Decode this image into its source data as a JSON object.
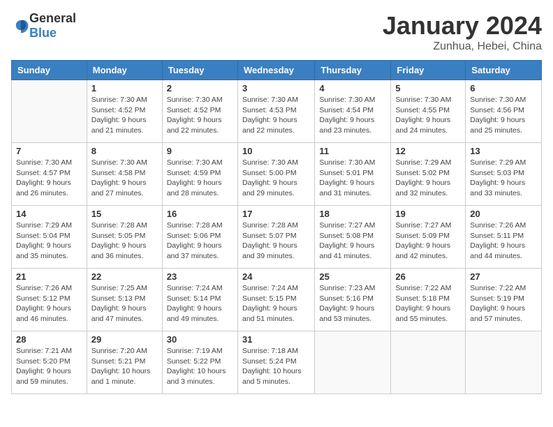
{
  "header": {
    "logo_general": "General",
    "logo_blue": "Blue",
    "month": "January 2024",
    "location": "Zunhua, Hebei, China"
  },
  "columns": [
    "Sunday",
    "Monday",
    "Tuesday",
    "Wednesday",
    "Thursday",
    "Friday",
    "Saturday"
  ],
  "weeks": [
    [
      {
        "day": "",
        "info": ""
      },
      {
        "day": "1",
        "info": "Sunrise: 7:30 AM\nSunset: 4:52 PM\nDaylight: 9 hours\nand 21 minutes."
      },
      {
        "day": "2",
        "info": "Sunrise: 7:30 AM\nSunset: 4:52 PM\nDaylight: 9 hours\nand 22 minutes."
      },
      {
        "day": "3",
        "info": "Sunrise: 7:30 AM\nSunset: 4:53 PM\nDaylight: 9 hours\nand 22 minutes."
      },
      {
        "day": "4",
        "info": "Sunrise: 7:30 AM\nSunset: 4:54 PM\nDaylight: 9 hours\nand 23 minutes."
      },
      {
        "day": "5",
        "info": "Sunrise: 7:30 AM\nSunset: 4:55 PM\nDaylight: 9 hours\nand 24 minutes."
      },
      {
        "day": "6",
        "info": "Sunrise: 7:30 AM\nSunset: 4:56 PM\nDaylight: 9 hours\nand 25 minutes."
      }
    ],
    [
      {
        "day": "7",
        "info": "Sunrise: 7:30 AM\nSunset: 4:57 PM\nDaylight: 9 hours\nand 26 minutes."
      },
      {
        "day": "8",
        "info": "Sunrise: 7:30 AM\nSunset: 4:58 PM\nDaylight: 9 hours\nand 27 minutes."
      },
      {
        "day": "9",
        "info": "Sunrise: 7:30 AM\nSunset: 4:59 PM\nDaylight: 9 hours\nand 28 minutes."
      },
      {
        "day": "10",
        "info": "Sunrise: 7:30 AM\nSunset: 5:00 PM\nDaylight: 9 hours\nand 29 minutes."
      },
      {
        "day": "11",
        "info": "Sunrise: 7:30 AM\nSunset: 5:01 PM\nDaylight: 9 hours\nand 31 minutes."
      },
      {
        "day": "12",
        "info": "Sunrise: 7:29 AM\nSunset: 5:02 PM\nDaylight: 9 hours\nand 32 minutes."
      },
      {
        "day": "13",
        "info": "Sunrise: 7:29 AM\nSunset: 5:03 PM\nDaylight: 9 hours\nand 33 minutes."
      }
    ],
    [
      {
        "day": "14",
        "info": "Sunrise: 7:29 AM\nSunset: 5:04 PM\nDaylight: 9 hours\nand 35 minutes."
      },
      {
        "day": "15",
        "info": "Sunrise: 7:28 AM\nSunset: 5:05 PM\nDaylight: 9 hours\nand 36 minutes."
      },
      {
        "day": "16",
        "info": "Sunrise: 7:28 AM\nSunset: 5:06 PM\nDaylight: 9 hours\nand 37 minutes."
      },
      {
        "day": "17",
        "info": "Sunrise: 7:28 AM\nSunset: 5:07 PM\nDaylight: 9 hours\nand 39 minutes."
      },
      {
        "day": "18",
        "info": "Sunrise: 7:27 AM\nSunset: 5:08 PM\nDaylight: 9 hours\nand 41 minutes."
      },
      {
        "day": "19",
        "info": "Sunrise: 7:27 AM\nSunset: 5:09 PM\nDaylight: 9 hours\nand 42 minutes."
      },
      {
        "day": "20",
        "info": "Sunrise: 7:26 AM\nSunset: 5:11 PM\nDaylight: 9 hours\nand 44 minutes."
      }
    ],
    [
      {
        "day": "21",
        "info": "Sunrise: 7:26 AM\nSunset: 5:12 PM\nDaylight: 9 hours\nand 46 minutes."
      },
      {
        "day": "22",
        "info": "Sunrise: 7:25 AM\nSunset: 5:13 PM\nDaylight: 9 hours\nand 47 minutes."
      },
      {
        "day": "23",
        "info": "Sunrise: 7:24 AM\nSunset: 5:14 PM\nDaylight: 9 hours\nand 49 minutes."
      },
      {
        "day": "24",
        "info": "Sunrise: 7:24 AM\nSunset: 5:15 PM\nDaylight: 9 hours\nand 51 minutes."
      },
      {
        "day": "25",
        "info": "Sunrise: 7:23 AM\nSunset: 5:16 PM\nDaylight: 9 hours\nand 53 minutes."
      },
      {
        "day": "26",
        "info": "Sunrise: 7:22 AM\nSunset: 5:18 PM\nDaylight: 9 hours\nand 55 minutes."
      },
      {
        "day": "27",
        "info": "Sunrise: 7:22 AM\nSunset: 5:19 PM\nDaylight: 9 hours\nand 57 minutes."
      }
    ],
    [
      {
        "day": "28",
        "info": "Sunrise: 7:21 AM\nSunset: 5:20 PM\nDaylight: 9 hours\nand 59 minutes."
      },
      {
        "day": "29",
        "info": "Sunrise: 7:20 AM\nSunset: 5:21 PM\nDaylight: 10 hours\nand 1 minute."
      },
      {
        "day": "30",
        "info": "Sunrise: 7:19 AM\nSunset: 5:22 PM\nDaylight: 10 hours\nand 3 minutes."
      },
      {
        "day": "31",
        "info": "Sunrise: 7:18 AM\nSunset: 5:24 PM\nDaylight: 10 hours\nand 5 minutes."
      },
      {
        "day": "",
        "info": ""
      },
      {
        "day": "",
        "info": ""
      },
      {
        "day": "",
        "info": ""
      }
    ]
  ]
}
